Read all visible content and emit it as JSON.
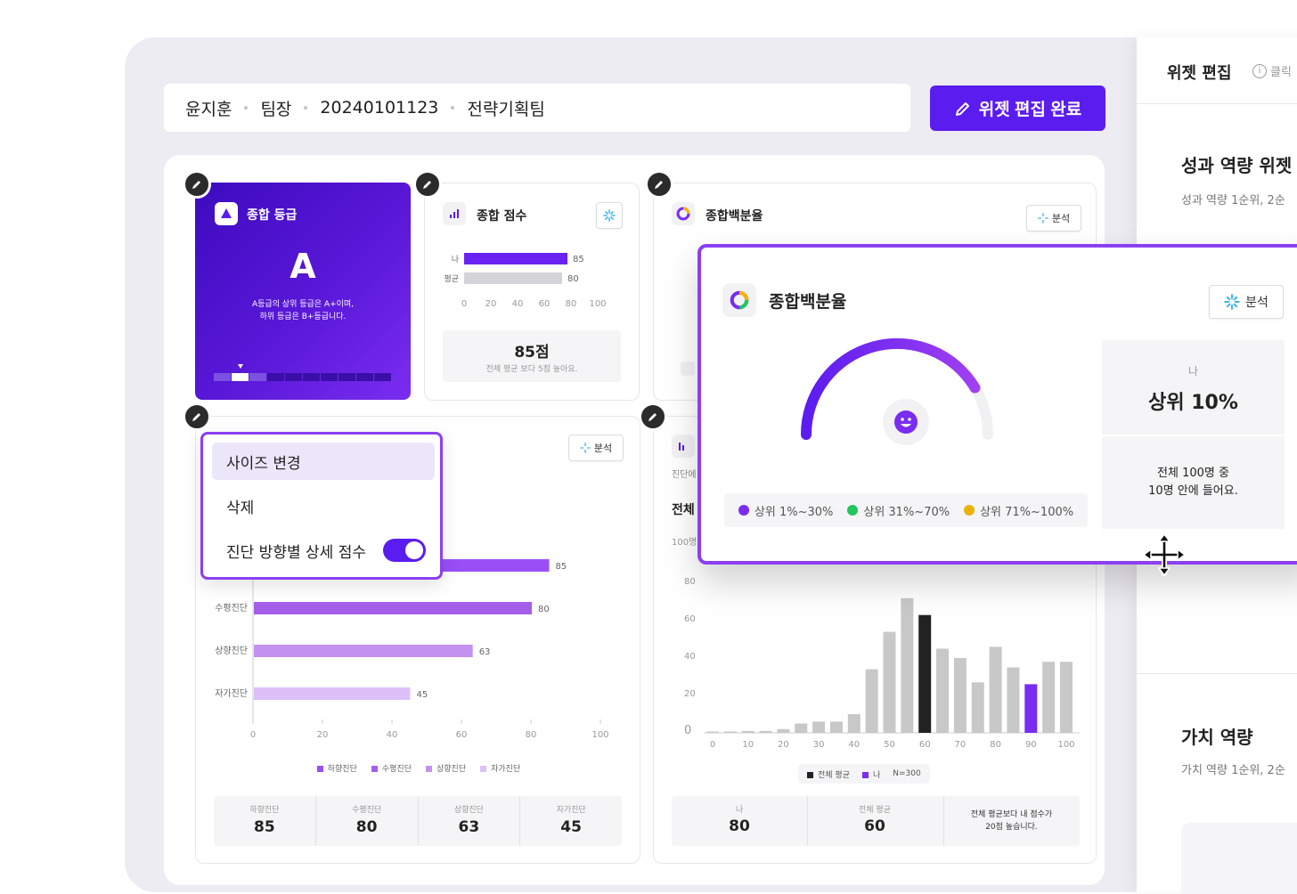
{
  "header": {
    "name": "윤지훈",
    "position": "팀장",
    "employee_id": "20240101123",
    "team": "전략기획팀",
    "done_button": "위젯 편집 완료"
  },
  "colors": {
    "accent": "#5b1cf0",
    "highlight": "#8c3ff0",
    "grade_bg": "#4a12cc"
  },
  "grade_card": {
    "title": "종합 등급",
    "grade": "A",
    "desc_line1": "A등급의 상위 등급은 A+이며,",
    "desc_line2": "하위 등급은 B+등급니다."
  },
  "score_card": {
    "title": "종합 점수",
    "bars": [
      {
        "label": "나",
        "value": 85
      },
      {
        "label": "평균",
        "value": 80
      }
    ],
    "ticks": [
      "0",
      "20",
      "40",
      "60",
      "80",
      "100"
    ],
    "score": "85점",
    "desc": "전체 평균 보다 5점 높아요."
  },
  "percent_card": {
    "title": "종합백분율",
    "analysis": "분석"
  },
  "direction_card": {
    "analysis": "분석",
    "bars": [
      {
        "label": "하향진단",
        "value": 85,
        "color": "#9a4ff5"
      },
      {
        "label": "수평진단",
        "value": 80,
        "color": "#a45ee8"
      },
      {
        "label": "상향진단",
        "value": 63,
        "color": "#c392f0"
      },
      {
        "label": "자가진단",
        "value": 45,
        "color": "#dcc0f7"
      }
    ],
    "ticks": [
      "0",
      "20",
      "40",
      "60",
      "80",
      "100"
    ],
    "legend": [
      "하향진단",
      "수평진단",
      "상향진단",
      "자가진단"
    ],
    "stats": [
      {
        "label": "하향진단",
        "value": "85"
      },
      {
        "label": "수평진단",
        "value": "80"
      },
      {
        "label": "상향진단",
        "value": "63"
      },
      {
        "label": "자가진단",
        "value": "45"
      }
    ]
  },
  "context_menu": {
    "resize": "사이즈 변경",
    "delete": "삭제",
    "detail_toggle": "진단 방향별 상세 점수",
    "detail_toggle_on": true
  },
  "distribution_card": {
    "partial_label": "진단에",
    "partial_title": "전체",
    "ytop": "100명",
    "yticks": [
      "80",
      "60",
      "40",
      "20",
      "0"
    ],
    "xticks": [
      "0",
      "10",
      "20",
      "30",
      "40",
      "50",
      "60",
      "70",
      "80",
      "90",
      "100"
    ],
    "legend_avg": "전체 평균",
    "legend_me": "나",
    "legend_n": "N=300",
    "stats": {
      "me_label": "나",
      "me_value": "80",
      "avg_label": "전체 평균",
      "avg_value": "60",
      "note_line1": "전체 평균보다 내 점수가",
      "note_line2": "20점 높습니다."
    }
  },
  "chart_data": [
    {
      "type": "bar",
      "title": "종합 점수",
      "categories": [
        "나",
        "평균"
      ],
      "values": [
        85,
        80
      ],
      "xlim": [
        0,
        100
      ]
    },
    {
      "type": "bar",
      "categories": [
        "하향진단",
        "수평진단",
        "상향진단",
        "자가진단"
      ],
      "values": [
        85,
        80,
        63,
        45
      ],
      "xlim": [
        0,
        100
      ]
    },
    {
      "type": "bar",
      "title": "전체",
      "x": [
        0,
        5,
        10,
        15,
        20,
        25,
        30,
        35,
        40,
        45,
        50,
        55,
        60,
        65,
        70,
        75,
        80,
        85,
        90,
        95,
        100
      ],
      "values": [
        0,
        0,
        1,
        1,
        2,
        5,
        6,
        6,
        10,
        34,
        54,
        72,
        63,
        45,
        40,
        27,
        46,
        35,
        26,
        38,
        38
      ],
      "highlight": {
        "전체 평균": 60,
        "나": 90
      },
      "ylim": [
        0,
        100
      ]
    },
    {
      "type": "gauge",
      "title": "종합백분율",
      "value": 10,
      "range": [
        0,
        100
      ]
    }
  ],
  "percent_popup": {
    "title": "종합백분율",
    "analysis": "분석",
    "my_label": "나",
    "my_value": "상위 10%",
    "desc_line1": "전체 100명 중",
    "desc_line2": "10명 안에 들어요.",
    "legend": [
      {
        "label": "상위 1%~30%",
        "color": "#7a2df0"
      },
      {
        "label": "상위 31%~70%",
        "color": "#22c55e"
      },
      {
        "label": "상위 71%~100%",
        "color": "#eab308"
      }
    ]
  },
  "side_panel": {
    "title": "위젯 편집",
    "hint": "클릭",
    "section1_title": "성과 역량 위젯",
    "section1_desc": "성과 역량 1순위, 2순",
    "section2_title": "가치 역량",
    "section2_desc": "가치 역량 1순위, 2순"
  }
}
